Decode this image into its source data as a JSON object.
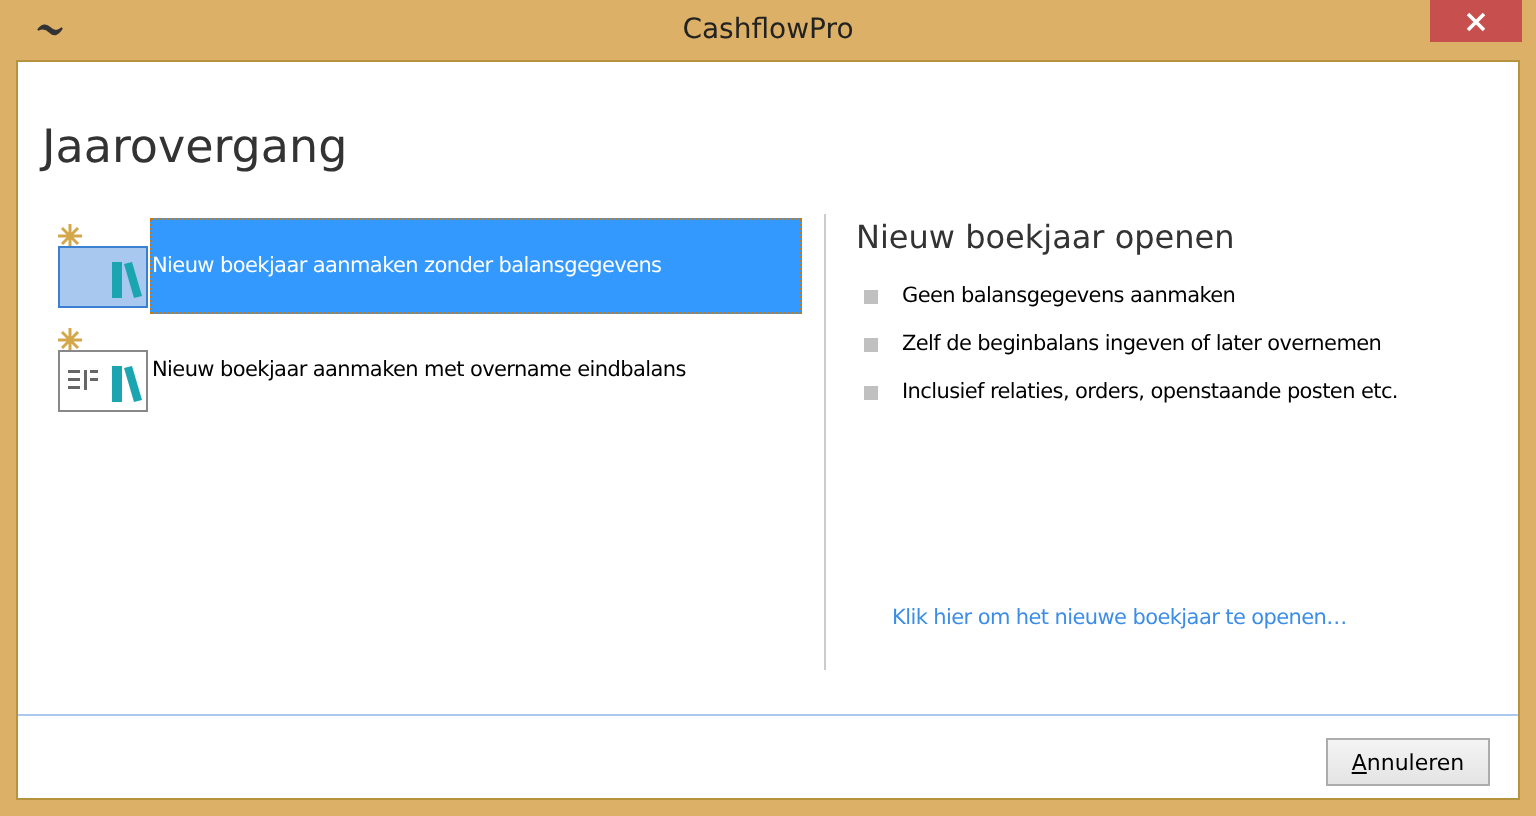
{
  "window": {
    "title": "CashflowPro"
  },
  "heading": "Jaarovergang",
  "options": [
    {
      "label": "Nieuw boekjaar aanmaken zonder balansgegevens",
      "selected": true,
      "kind": "empty"
    },
    {
      "label": "Nieuw boekjaar aanmaken met overname eindbalans",
      "selected": false,
      "kind": "balance"
    }
  ],
  "details": {
    "title": "Nieuw boekjaar openen",
    "bullets": [
      "Geen balansgegevens aanmaken",
      "Zelf de beginbalans ingeven of later overnemen",
      "Inclusief relaties, orders, openstaande posten etc."
    ],
    "link": "Klik hier om het nieuwe boekjaar te openen…"
  },
  "buttons": [
    "Annuleren"
  ]
}
